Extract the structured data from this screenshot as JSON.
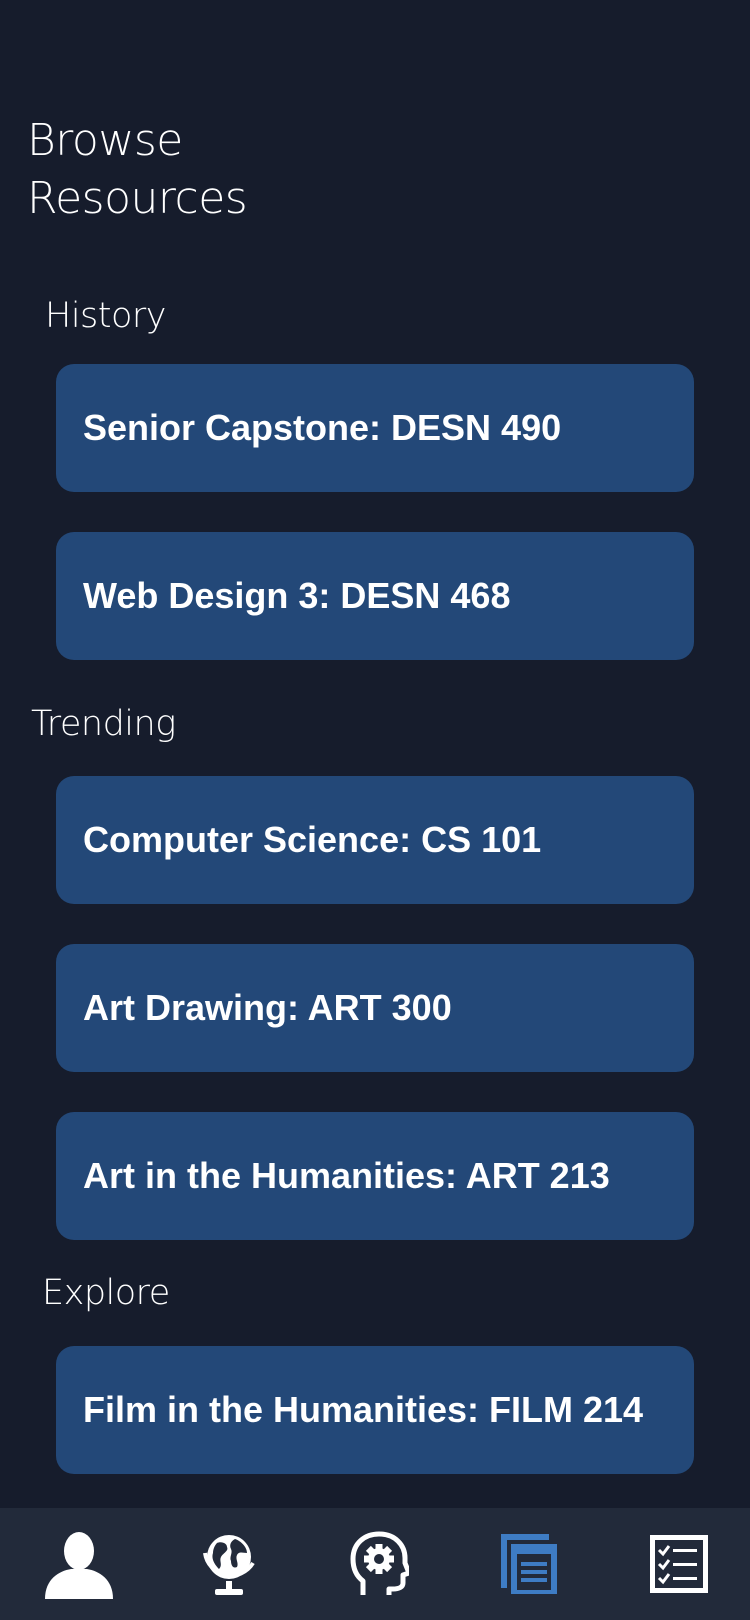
{
  "page": {
    "title_line1": "Browse",
    "title_line2": "Resources"
  },
  "sections": {
    "history": {
      "label": "History",
      "items": [
        {
          "label": "Senior Capstone: DESN 490"
        },
        {
          "label": "Web Design 3: DESN 468"
        }
      ]
    },
    "trending": {
      "label": "Trending",
      "items": [
        {
          "label": "Computer Science: CS 101"
        },
        {
          "label": "Art Drawing: ART 300"
        },
        {
          "label": "Art in the Humanities: ART 213"
        }
      ]
    },
    "explore": {
      "label": "Explore",
      "items": [
        {
          "label": "Film in the Humanities: FILM 214"
        }
      ]
    }
  },
  "tabbar": {
    "active_tab": "resources",
    "tabs": [
      {
        "id": "profile",
        "icon": "person-icon"
      },
      {
        "id": "global",
        "icon": "globe-icon"
      },
      {
        "id": "mind",
        "icon": "head-gear-icon"
      },
      {
        "id": "resources",
        "icon": "documents-icon"
      },
      {
        "id": "checklist",
        "icon": "checklist-icon"
      }
    ]
  },
  "colors": {
    "background": "#161c2c",
    "card": "#234878",
    "tabbar": "#222a3a",
    "active_tab": "#3e7cc4",
    "text": "#ffffff"
  }
}
